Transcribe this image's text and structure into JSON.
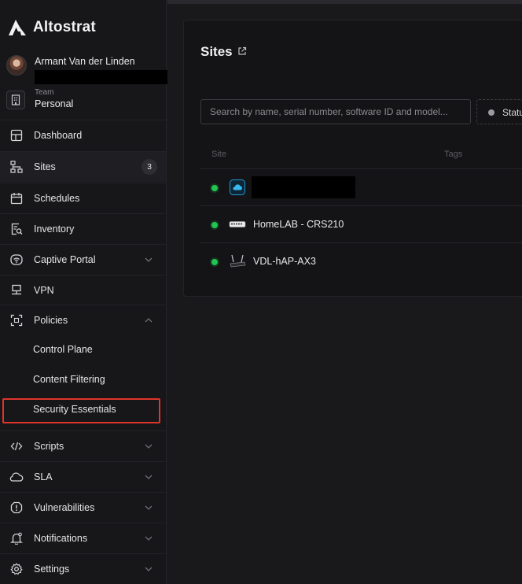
{
  "app": {
    "name": "Altostrat"
  },
  "user": {
    "name": "Armant Van der Linden"
  },
  "team": {
    "label": "Team",
    "value": "Personal"
  },
  "nav": {
    "dashboard": "Dashboard",
    "sites": "Sites",
    "sites_count": "3",
    "schedules": "Schedules",
    "inventory": "Inventory",
    "captive_portal": "Captive Portal",
    "vpn": "VPN",
    "policies": "Policies",
    "policies_sub": {
      "control_plane": "Control Plane",
      "content_filtering": "Content Filtering",
      "security_essentials": "Security Essentials"
    },
    "scripts": "Scripts",
    "sla": "SLA",
    "vulnerabilities": "Vulnerabilities",
    "notifications": "Notifications",
    "settings": "Settings"
  },
  "main": {
    "title": "Sites",
    "search_placeholder": "Search by name, serial number, software ID and model...",
    "status_filter": "Status",
    "columns": {
      "site": "Site",
      "tags": "Tags"
    },
    "rows": [
      {
        "name": "",
        "device_icon": "cloud-icon",
        "status": "online"
      },
      {
        "name": "HomeLAB - CRS210",
        "device_icon": "switch-icon",
        "status": "online"
      },
      {
        "name": "VDL-hAP-AX3",
        "device_icon": "router-icon",
        "status": "online"
      }
    ]
  },
  "colors": {
    "background": "#19191c",
    "sidebar": "#17171a",
    "panel": "#141416",
    "online": "#23c552",
    "highlight": "#e0342b",
    "cloud": "#1d9bd8"
  }
}
